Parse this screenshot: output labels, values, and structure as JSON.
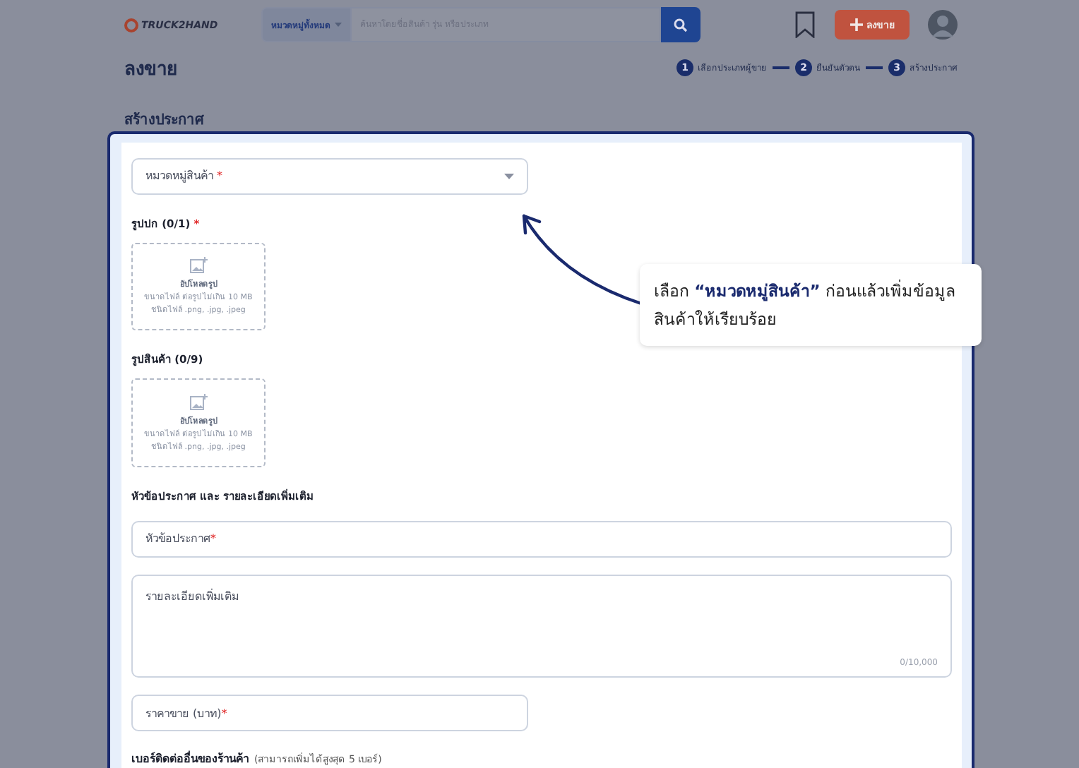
{
  "header": {
    "logo": "TRUCK2HAND",
    "category_dropdown": {
      "label": "หมวดหมู่ทั้งหมด"
    },
    "search": {
      "placeholder": "ค้นหาโดยชื่อสินค้า รุ่น หรือประเภท"
    },
    "post_button": {
      "label": "ลงขาย"
    }
  },
  "page_title": "ลงขาย",
  "steps": [
    {
      "number": "1",
      "label": "เลือกประเภทผู้ขาย"
    },
    {
      "number": "2",
      "label": "ยืนยันตัวตน"
    },
    {
      "number": "3",
      "label": "สร้างประกาศ"
    }
  ],
  "section_title": "สร้างประกาศ",
  "form": {
    "category_field": {
      "placeholder": "หมวดหมู่สินค้า",
      "required_mark": "*"
    },
    "cover_images": {
      "label": "รูปปก (0/1)",
      "required_mark": "*",
      "upload": {
        "title": "อัปโหลดรูป",
        "size_note": "ขนาดไฟล์ ต่อรูป ไม่เกิน 10 MB",
        "type_note": "ชนิดไฟล์ .png, .jpg, .jpeg"
      }
    },
    "product_images": {
      "label": "รูปสินค้า (0/9)",
      "upload": {
        "title": "อัปโหลดรูป",
        "size_note": "ขนาดไฟล์ ต่อรูป ไม่เกิน 10 MB",
        "type_note": "ชนิดไฟล์ .png, .jpg, .jpeg"
      }
    },
    "details_heading": "หัวข้อประกาศ และ รายละเอียดเพิ่มเติม",
    "title_field": {
      "placeholder": "หัวข้อประกาศ",
      "required_mark": "*"
    },
    "description_field": {
      "placeholder": "รายละเอียดเพิ่มเติม",
      "counter": "0/10,000"
    },
    "price_field": {
      "placeholder": "ราคาขาย (บาท)",
      "required_mark": "*"
    },
    "phone_heading": {
      "label": "เบอร์ติดต่ออื่นของร้านค้า",
      "note": "(สามารถเพิ่มได้สูงสุด 5 เบอร์)"
    }
  },
  "callout": {
    "text": "เลือก **“หมวดหมู่สินค้า”** ก่อนแล้วเพิ่มข้อมูลสินค้าให้เรียบร้อย"
  }
}
